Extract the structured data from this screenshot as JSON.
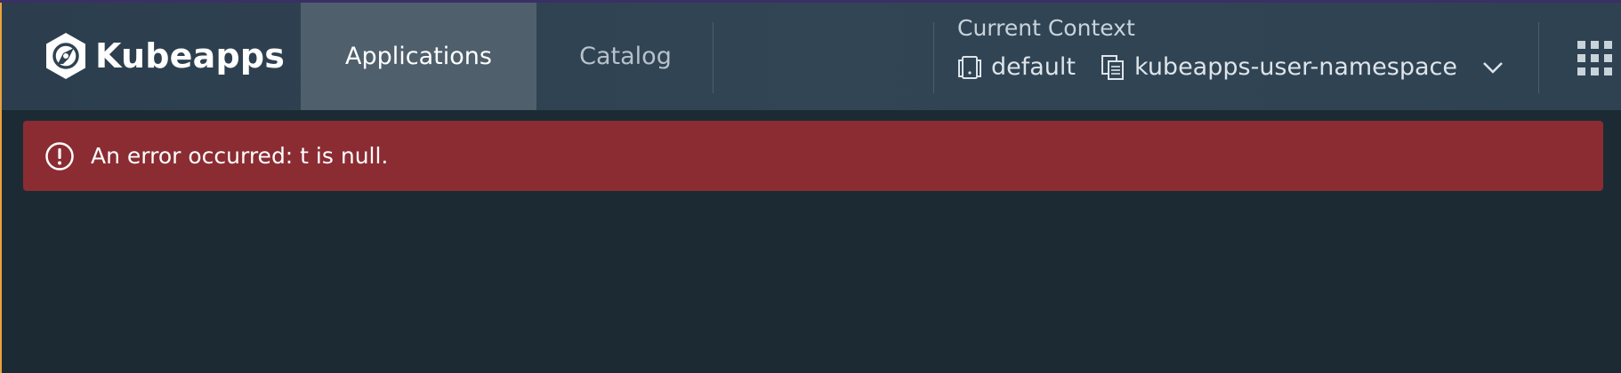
{
  "brand": {
    "name": "Kubeapps",
    "logo_icon": "kubeapps-logo-icon"
  },
  "nav": {
    "tabs": [
      {
        "label": "Applications",
        "active": true
      },
      {
        "label": "Catalog",
        "active": false
      }
    ]
  },
  "context": {
    "title": "Current Context",
    "cluster": "default",
    "namespace": "kubeapps-user-namespace",
    "cluster_icon": "cluster-icon",
    "namespace_icon": "namespace-icon",
    "dropdown_icon": "chevron-down-icon"
  },
  "apps_menu_icon": "apps-grid-icon",
  "alert": {
    "message": "An error occurred: t is null.",
    "icon": "error-icon",
    "color": "#8b2c33"
  },
  "colors": {
    "header": "#2f4252",
    "active_tab": "#4f5f6c",
    "background": "#1c2b33",
    "accent_edge": "#e9a23b"
  }
}
